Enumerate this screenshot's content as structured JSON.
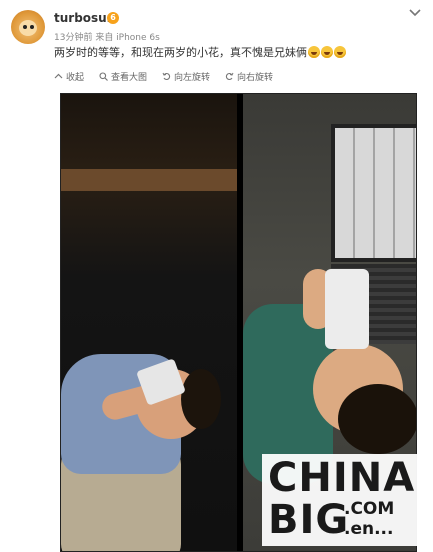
{
  "post": {
    "username": "turbosun",
    "vip_badge": "6",
    "meta": "13分钟前 来自 iPhone 6s",
    "content": "两岁时的等等，和现在两岁的小花，真不愧是兄妹俩"
  },
  "toolbar": {
    "collapse": "收起",
    "view_large": "查看大图",
    "rotate_left": "向左旋转",
    "rotate_right": "向右旋转"
  },
  "watermark": {
    "line1": "CHINA",
    "line2": "BIG",
    "com": ".COM",
    "en": ".en..."
  },
  "colors": {
    "accent_vip": "#f7a21b",
    "text": "#333333",
    "meta": "#888888"
  }
}
